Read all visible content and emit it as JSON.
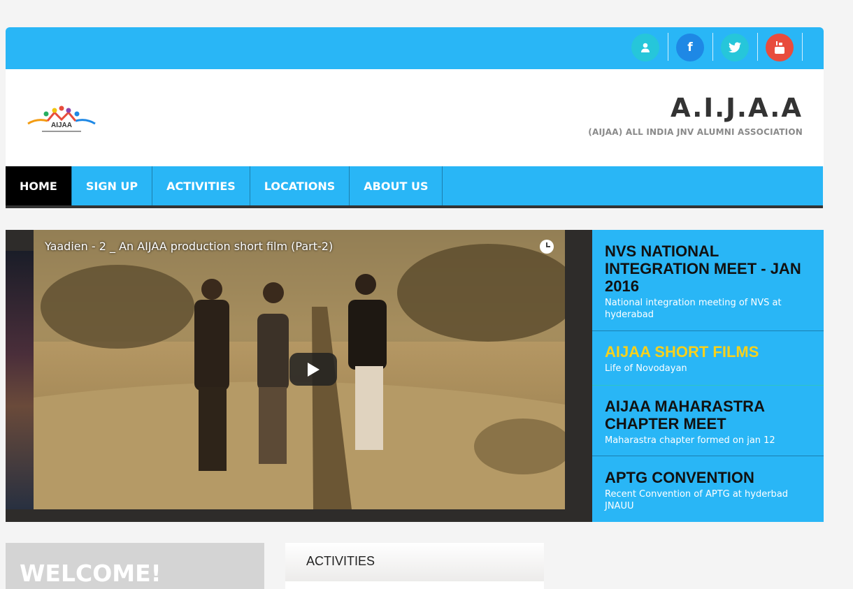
{
  "topbar": {
    "icons": [
      {
        "name": "user-icon",
        "color": "#26c6da"
      },
      {
        "name": "facebook-icon",
        "color": "#1e88e5"
      },
      {
        "name": "twitter-icon",
        "color": "#26c6da"
      },
      {
        "name": "youtube-icon",
        "color": "#e84c3d"
      }
    ]
  },
  "header": {
    "logo_text": "AIJAA",
    "site_title": "A.I.J.A.A",
    "site_subtitle": "(AIJAA) ALL INDIA JNV ALUMNI ASSOCIATION"
  },
  "nav": {
    "items": [
      {
        "label": "HOME",
        "active": true
      },
      {
        "label": "SIGN UP"
      },
      {
        "label": "ACTIVITIES"
      },
      {
        "label": "LOCATIONS"
      },
      {
        "label": "ABOUT US"
      }
    ]
  },
  "video": {
    "title": "Yaadien - 2 _ An AIJAA production short film (Part-2)"
  },
  "news": [
    {
      "title": "NVS NATIONAL INTEGRATION MEET - JAN 2016",
      "desc": "National integration meeting of NVS at hyderabad"
    },
    {
      "title": "AIJAA SHORT FILMS",
      "desc": "Life of Novodayan",
      "highlight": true
    },
    {
      "title": "AIJAA MAHARASTRA CHAPTER MEET",
      "desc": "Maharastra chapter formed on jan 12"
    },
    {
      "title": "APTG CONVENTION",
      "desc": "Recent Convention of APTG at hyderbad JNAUU"
    }
  ],
  "welcome": {
    "title": "WELCOME!"
  },
  "activities": {
    "title": "ACTIVITIES"
  },
  "colors": {
    "accent": "#29b6f6",
    "highlight": "#f7d11c",
    "nav_active": "#000000"
  }
}
